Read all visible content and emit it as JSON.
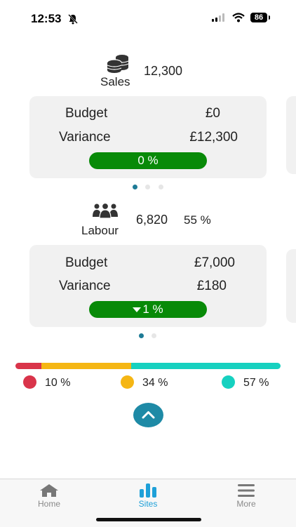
{
  "status_bar": {
    "time": "12:53",
    "battery": "86"
  },
  "sales": {
    "label": "Sales",
    "value": "12,300",
    "budget_label": "Budget",
    "budget_value": "£0",
    "variance_label": "Variance",
    "variance_value": "£12,300",
    "percent_text": "0 %"
  },
  "labour": {
    "label": "Labour",
    "value": "6,820",
    "percent": "55 %",
    "budget_label": "Budget",
    "budget_value": "£7,000",
    "variance_label": "Variance",
    "variance_value": "£180",
    "percent_text": "1 %",
    "trend_icon": "triangle-down-icon"
  },
  "distribution": {
    "segments": [
      {
        "color": "#d9344a",
        "percent": 10,
        "label": "10 %"
      },
      {
        "color": "#f5b614",
        "percent": 34,
        "label": "34 %"
      },
      {
        "color": "#16d1c0",
        "percent": 57,
        "label": "57 %"
      }
    ]
  },
  "tabs": [
    {
      "label": "Home",
      "icon": "home-icon",
      "active": false
    },
    {
      "label": "Sites",
      "icon": "bar-chart-icon",
      "active": true
    },
    {
      "label": "More",
      "icon": "menu-icon",
      "active": false
    }
  ],
  "colors": {
    "accent": "#1e8aa6",
    "pill_green": "#088a08",
    "card_bg": "#f1f1f1",
    "active_tab": "#1ea0d8"
  }
}
